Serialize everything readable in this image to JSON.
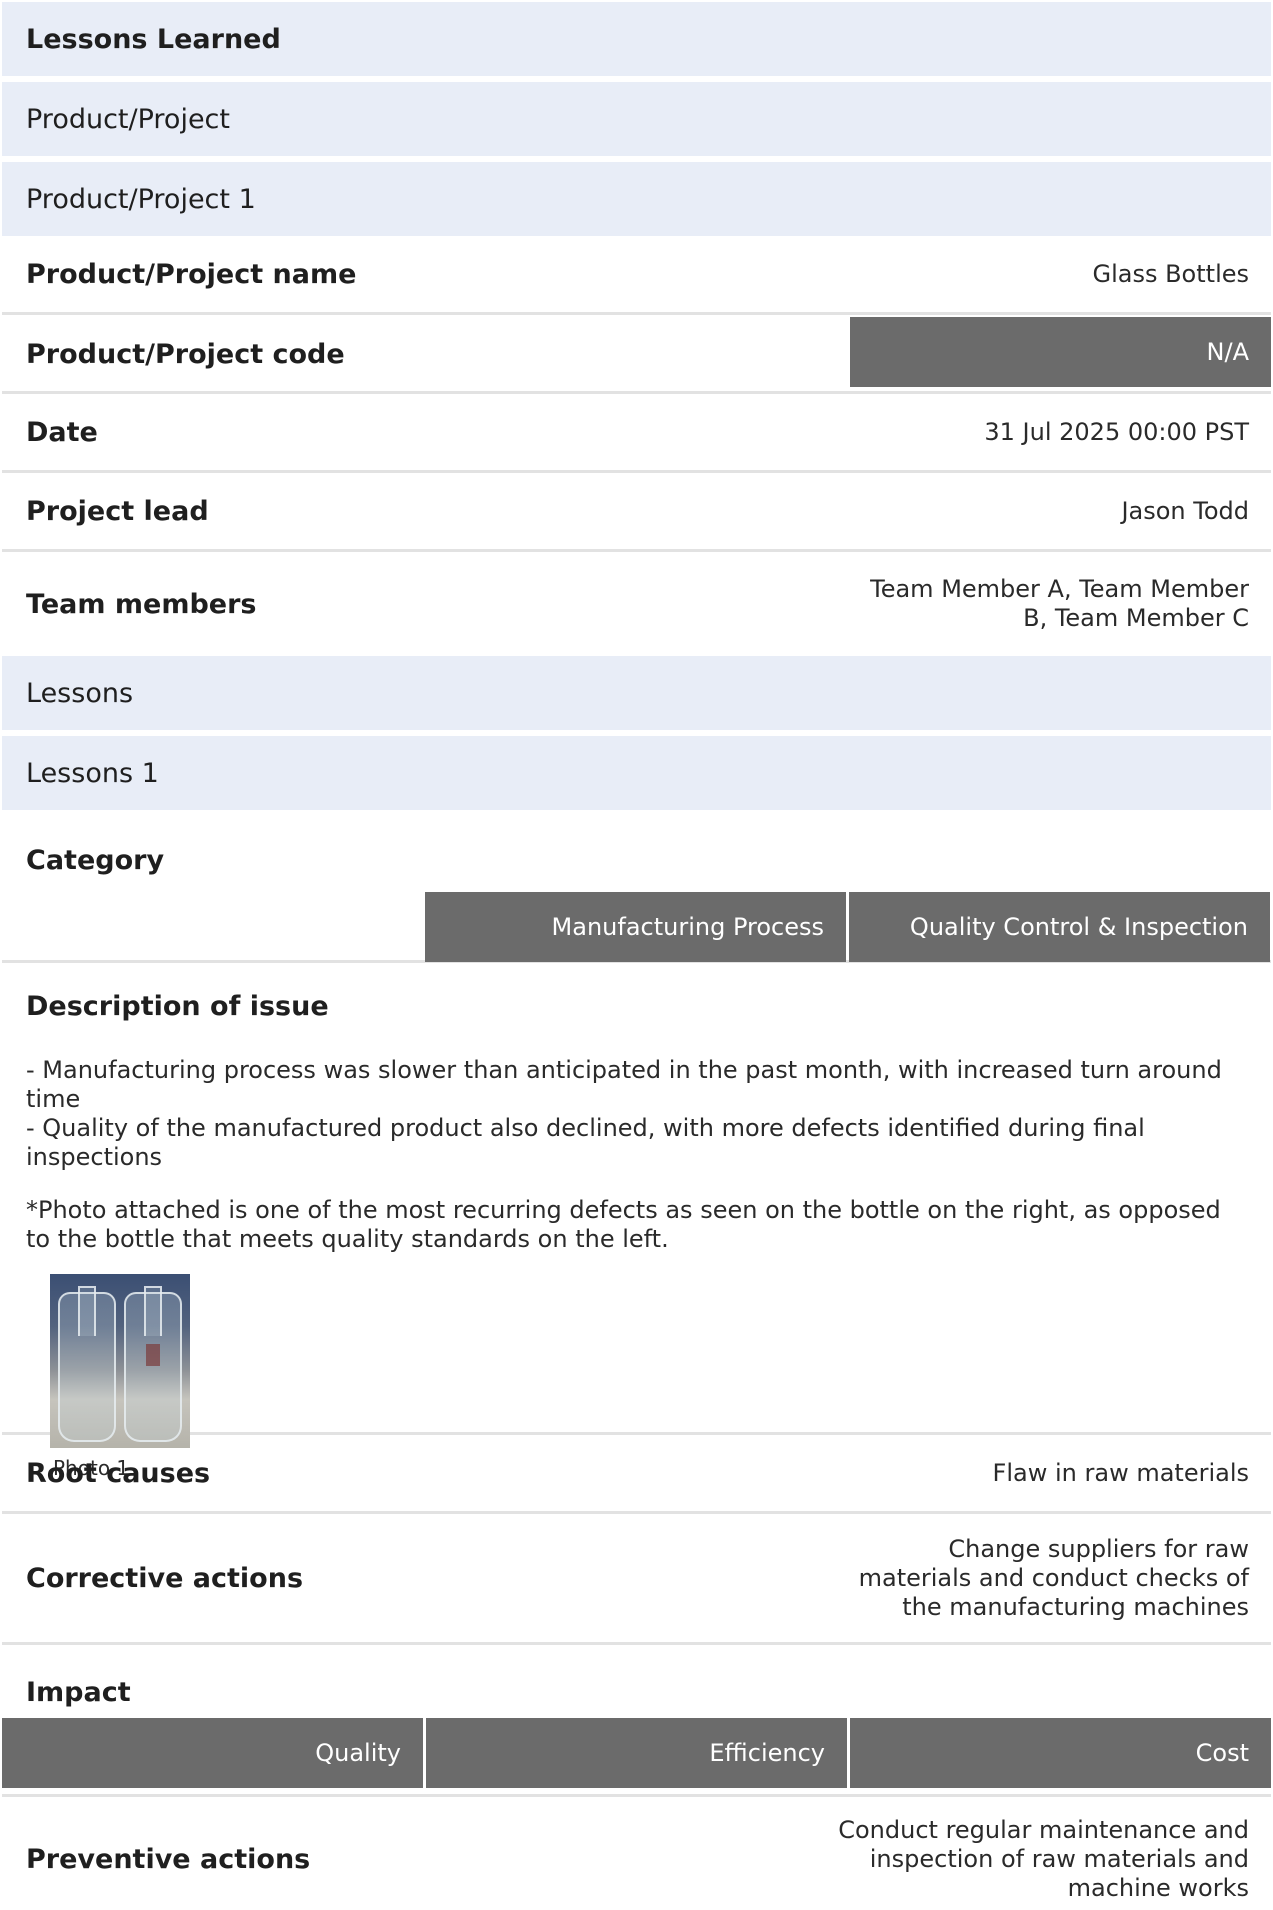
{
  "header": {
    "title": "Lessons Learned",
    "section_product": "Product/Project",
    "subsection_product": "Product/Project 1"
  },
  "product": {
    "name_label": "Product/Project name",
    "name_value": "Glass Bottles",
    "code_label": "Product/Project code",
    "code_value": "N/A",
    "date_label": "Date",
    "date_value": "31 Jul 2025 00:00 PST",
    "lead_label": "Project lead",
    "lead_value": "Jason Todd",
    "team_label": "Team members",
    "team_value_line1": "Team Member A, Team Member",
    "team_value_line2": "B, Team Member C"
  },
  "lessons": {
    "section": "Lessons",
    "subsection": "Lessons 1",
    "category_label": "Category",
    "categories": [
      "Manufacturing Process",
      "Quality Control & Inspection"
    ],
    "description_label": "Description of issue",
    "description_line1": "- Manufacturing process was slower than anticipated in the past month, with increased turn around time",
    "description_line2": "- Quality of the manufactured product also declined, with more defects identified during final inspections",
    "description_note": "*Photo attached is one of the most recurring defects as seen on the bottle on the right, as opposed to the bottle that meets quality standards on the left.",
    "photo_caption": "Photo 1",
    "root_causes_label": "Root causes",
    "root_causes_value": "Flaw in raw materials",
    "corrective_label": "Corrective actions",
    "corrective_line1": "Change suppliers for raw",
    "corrective_line2": "materials and conduct checks of",
    "corrective_line3": "the manufacturing machines",
    "impact_label": "Impact",
    "impacts": [
      "Quality",
      "Efficiency",
      "Cost"
    ],
    "preventive_label": "Preventive actions",
    "preventive_line1": "Conduct regular maintenance and",
    "preventive_line2": "inspection of raw materials and",
    "preventive_line3": "machine works"
  }
}
